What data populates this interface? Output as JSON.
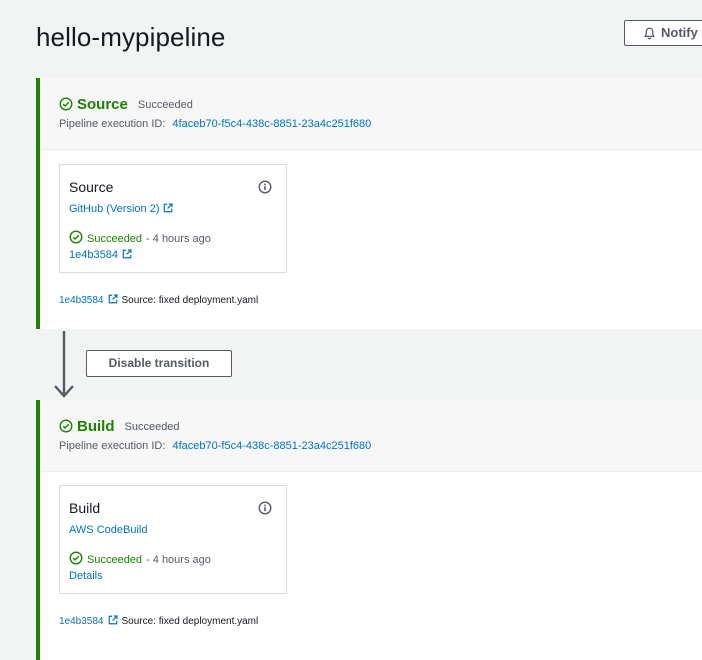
{
  "breadcrumb_fade": "· · · · · ·",
  "page": {
    "title": "hello-mypipeline",
    "notify_label": "Notify"
  },
  "colors": {
    "success": "#1d8102",
    "link": "#0073bb",
    "text": "#16191f",
    "muted": "#545b64",
    "background": "#f2f3f3"
  },
  "stages": [
    {
      "name": "Source",
      "status": "Succeeded",
      "exec_label": "Pipeline execution ID:",
      "exec_id": "4faceb70-f5c4-438c-8851-23a4c251f680",
      "action": {
        "title": "Source",
        "provider": "GitHub (Version 2)",
        "status": "Succeeded",
        "time": "- 4 hours ago",
        "link": "1e4b3584"
      },
      "footer": {
        "commit": "1e4b3584",
        "message": "Source: fixed deployment.yaml"
      }
    },
    {
      "name": "Build",
      "status": "Succeeded",
      "exec_label": "Pipeline execution ID:",
      "exec_id": "4faceb70-f5c4-438c-8851-23a4c251f680",
      "action": {
        "title": "Build",
        "provider": "AWS CodeBuild",
        "status": "Succeeded",
        "time": "- 4 hours ago",
        "link": "Details"
      },
      "footer": {
        "commit": "1e4b3584",
        "message": "Source: fixed deployment.yaml"
      }
    }
  ],
  "transition": {
    "button_label": "Disable transition"
  }
}
